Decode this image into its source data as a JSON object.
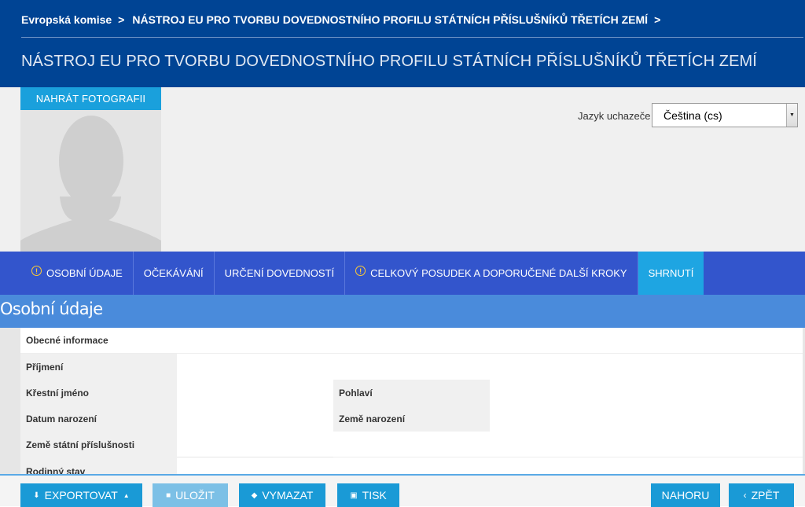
{
  "header": {
    "breadcrumb": [
      {
        "label": "Evropská komise"
      },
      {
        "label": "NÁSTROJ EU PRO TVORBU DOVEDNOSTNÍHO PROFILU STÁTNÍCH PŘÍSLUŠNÍKŮ TŘETÍCH ZEMÍ"
      }
    ],
    "breadcrumb_separator": ">",
    "title": "NÁSTROJ EU PRO TVORBU DOVEDNOSTNÍHO PROFILU STÁTNÍCH PŘÍSLUŠNÍKŮ TŘETÍCH ZEMÍ"
  },
  "photo": {
    "upload_label": "NAHRÁT FOTOGRAFII",
    "placeholder_icon": "person-silhouette-icon"
  },
  "language": {
    "label": "Jazyk uchazeče",
    "selected": "Čeština (cs)"
  },
  "tabs": [
    {
      "label": "OSOBNÍ ÚDAJE",
      "warning": true,
      "active": false
    },
    {
      "label": "OČEKÁVÁNÍ",
      "warning": false,
      "active": false
    },
    {
      "label": "URČENÍ DOVEDNOSTÍ",
      "warning": false,
      "active": false
    },
    {
      "label": "CELKOVÝ POSUDEK A DOPORUČENÉ DALŠÍ KROKY",
      "warning": true,
      "active": false
    },
    {
      "label": "SHRNUTÍ",
      "warning": false,
      "active": true
    }
  ],
  "section": {
    "title": "Osobní údaje",
    "group_title": "Obecné informace",
    "fields": {
      "surname": {
        "label": "Příjmení",
        "value": ""
      },
      "first_name": {
        "label": "Křestní jméno",
        "value": ""
      },
      "gender": {
        "label": "Pohlaví",
        "value": ""
      },
      "birth_date": {
        "label": "Datum narození",
        "value": ""
      },
      "birth_country": {
        "label": "Země narození",
        "value": ""
      },
      "citizenship": {
        "label": "Země státní příslušnosti",
        "value": ""
      },
      "marital_status": {
        "label": "Rodinný stav",
        "value": ""
      }
    }
  },
  "toolbar": {
    "export_label": "EXPORTOVAT",
    "save_label": "ULOŽIT",
    "clear_label": "VYMAZAT",
    "print_label": "TISK",
    "top_label": "NAHORU",
    "back_label": "ZPĚT"
  },
  "colors": {
    "header_bg": "#004494",
    "tab_bar": "#3355cc",
    "tab_active": "#1ea5e2",
    "section_bar": "#4a8bdb",
    "button": "#1a9ad6",
    "warning": "#ffcc33"
  }
}
